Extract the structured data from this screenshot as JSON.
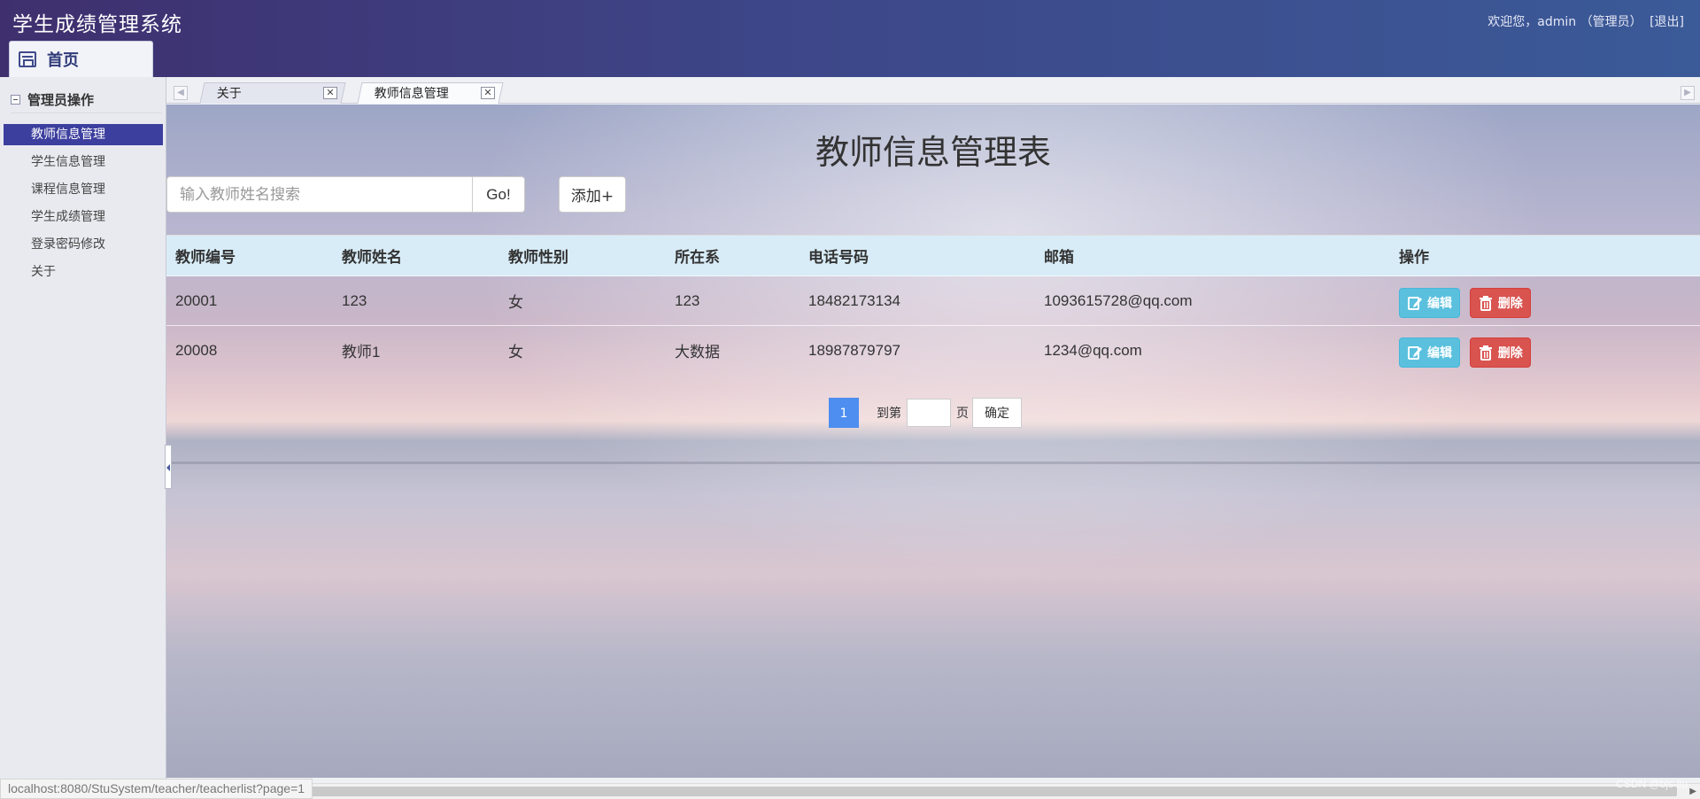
{
  "header": {
    "app_title": "学生成绩管理系统",
    "welcome_text": "欢迎您，admin （管理员）",
    "logout": "[退出]",
    "home_tab": "首页"
  },
  "sidebar": {
    "group_title": "管理员操作",
    "items": [
      {
        "label": "教师信息管理",
        "active": true
      },
      {
        "label": "学生信息管理",
        "active": false
      },
      {
        "label": "课程信息管理",
        "active": false
      },
      {
        "label": "学生成绩管理",
        "active": false
      },
      {
        "label": "登录密码修改",
        "active": false
      },
      {
        "label": "关于",
        "active": false
      }
    ]
  },
  "tabs": [
    {
      "label": "关于",
      "active": false
    },
    {
      "label": "教师信息管理",
      "active": true
    }
  ],
  "main": {
    "title": "教师信息管理表",
    "search_placeholder": "输入教师姓名搜索",
    "search_value": "",
    "go_button": "Go!",
    "add_button": "添加+"
  },
  "table": {
    "columns": [
      "教师编号",
      "教师姓名",
      "教师性别",
      "所在系",
      "电话号码",
      "邮箱",
      "操作"
    ],
    "rows": [
      {
        "id": "20001",
        "name": "123",
        "gender": "女",
        "dept": "123",
        "phone": "18482173134",
        "email": "1093615728@qq.com"
      },
      {
        "id": "20008",
        "name": "教师1",
        "gender": "女",
        "dept": "大数据",
        "phone": "18987879797",
        "email": "1234@qq.com"
      }
    ],
    "edit_label": "编辑",
    "delete_label": "删除"
  },
  "pagination": {
    "current_page": "1",
    "goto_label": "到第",
    "page_unit": "页",
    "confirm": "确定"
  },
  "status_bar": {
    "url": "localhost:8080/StuSystem/teacher/teacherlist?page=1",
    "watermark": "CSDN @bjs-liu"
  },
  "colors": {
    "header_start": "#3f2f6e",
    "header_end": "#3b5a98",
    "active_menu": "#3c3f9e",
    "edit_button": "#5bc0de",
    "delete_button": "#d9534f",
    "table_header": "#d8ecf7",
    "page_active": "#4d8ef0"
  }
}
